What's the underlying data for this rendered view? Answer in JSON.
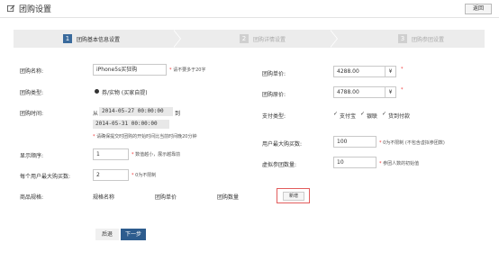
{
  "header": {
    "title": "团购设置",
    "back_label": "返回"
  },
  "steps": [
    {
      "num": "1",
      "label": "团购基本信息设置"
    },
    {
      "num": "2",
      "label": "团购详情设置"
    },
    {
      "num": "3",
      "label": "团购参团设置"
    }
  ],
  "form": {
    "name_label": "团购名称:",
    "name_value": "iPhone5s买狂购",
    "name_hint": "请不要多于20字",
    "type_label": "团购类型:",
    "type_option": "券/实物 (买家自提)",
    "time_label": "团购时间:",
    "time_from": "从",
    "time_start": "2014-05-27 00:00:00",
    "time_to": "到",
    "time_end": "2014-05-31 00:00:00",
    "time_hint": "请确保提交时团购的开始时间比当前时间晚20分钟",
    "order_label": "显示顺序:",
    "order_value": "1",
    "order_hint": "数值越小，展示越靠前",
    "max_label": "每个用户最大购买数:",
    "max_value": "2",
    "max_hint": "0为不限制",
    "spec_label": "商品规格:",
    "spec_col_name": "规格名称",
    "spec_col_price": "团购单价",
    "spec_col_qty": "团购数量",
    "add_label": "新增",
    "unit_price_label": "团购单价:",
    "unit_price_value": "4288.00",
    "orig_price_label": "团购原价:",
    "orig_price_value": "4788.00",
    "pay_label": "支付类型:",
    "pay_options": [
      "支付宝",
      "银联",
      "货到付款"
    ],
    "user_max_label": "用户最大购买数:",
    "user_max_value": "100",
    "user_max_hint": "0为不限制 (不包含虚拟参团数)",
    "virtual_label": "虚拟参团数量:",
    "virtual_value": "10",
    "virtual_hint": "参团人数的初始值",
    "yen_symbol": "¥"
  },
  "footer": {
    "prev_label": "后退",
    "next_label": "下一步"
  }
}
